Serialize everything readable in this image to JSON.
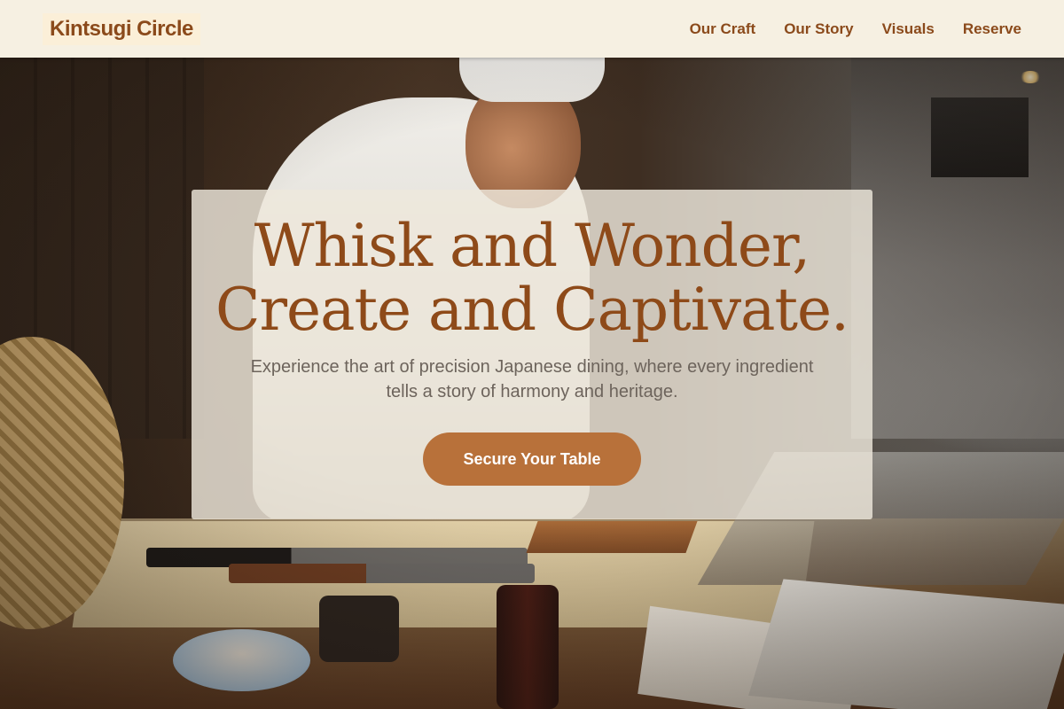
{
  "nav": {
    "brand": "Kintsugi Circle",
    "links": [
      {
        "label": "Our Craft"
      },
      {
        "label": "Our Story"
      },
      {
        "label": "Visuals"
      },
      {
        "label": "Reserve"
      }
    ]
  },
  "hero": {
    "headline_line1": "Whisk and Wonder,",
    "headline_line2": "Create and Captivate.",
    "subtext": "Experience the art of precision Japanese dining, where every ingredient tells a story of harmony and heritage.",
    "cta_label": "Secure Your Table",
    "background_image": "chef-preparing-sushi-photo"
  },
  "colors": {
    "brand_brown": "#8b4a1b",
    "nav_background": "#f6f0e2",
    "cta_background": "#b8713a",
    "card_background": "#eee8dc"
  }
}
